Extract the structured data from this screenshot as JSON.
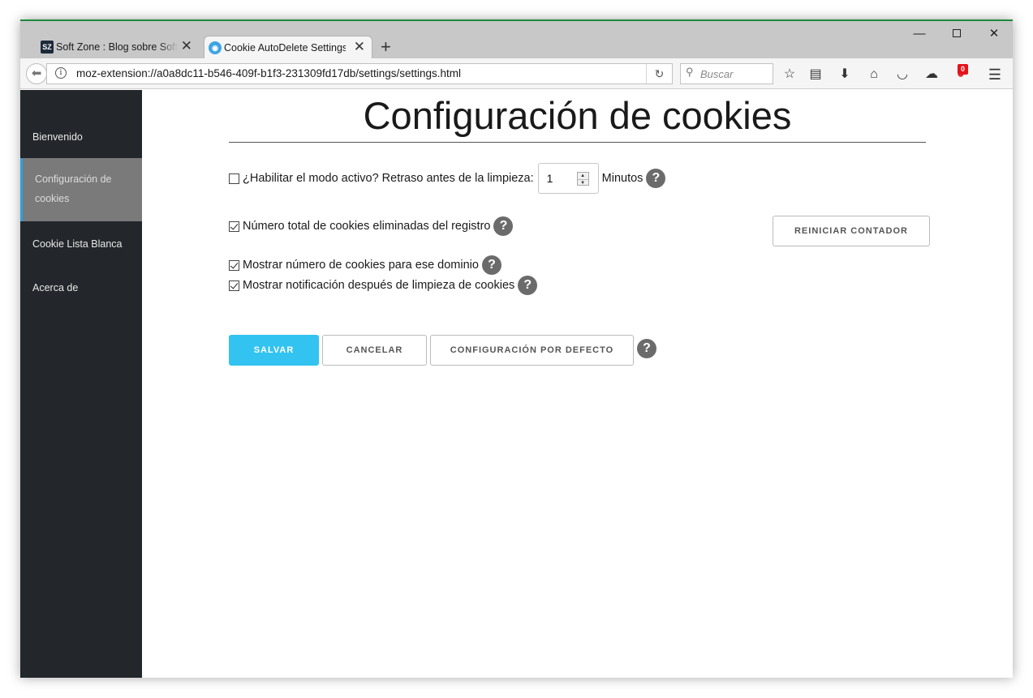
{
  "browser": {
    "tabs": [
      {
        "title": "Soft Zone : Blog sobre Software",
        "favicon": "SZ",
        "active": false
      },
      {
        "title": "Cookie AutoDelete Settings",
        "favicon": "cookie-autodelete-icon",
        "active": true
      }
    ],
    "new_tab": "+",
    "url": "moz-extension://a0a8dc11-b546-409f-b1f3-231309fd17db/settings/settings.html",
    "search_placeholder": "Buscar",
    "badge_count": "0",
    "toolbar_icons": [
      "star-icon",
      "reading-list-icon",
      "download-icon",
      "home-icon",
      "pocket-icon",
      "sync-icon",
      "cookie-autodelete-icon",
      "menu-icon"
    ]
  },
  "sidebar": {
    "items": [
      {
        "label": "Bienvenido",
        "active": false
      },
      {
        "label": "Configuración de cookies",
        "active": true
      },
      {
        "label": "Cookie Lista Blanca",
        "active": false
      },
      {
        "label": "Acerca de",
        "active": false
      }
    ]
  },
  "main": {
    "title": "Configuración de cookies",
    "active_mode": {
      "label": "¿Habilitar el modo activo? Retraso antes de la limpieza:",
      "checked": false,
      "delay_value": "1",
      "unit": "Minutos"
    },
    "stat_logging": {
      "label": "Número total de cookies eliminadas del registro",
      "checked": true
    },
    "reset_counter": "REINICIAR CONTADOR",
    "show_number": {
      "label": "Mostrar número de cookies para ese dominio",
      "checked": true
    },
    "show_notification": {
      "label": "Mostrar notificación después de limpieza de cookies",
      "checked": true
    },
    "buttons": {
      "save": "SALVAR",
      "cancel": "CANCELAR",
      "defaults": "CONFIGURACIÓN POR DEFECTO"
    },
    "help_glyph": "?"
  },
  "colors": {
    "sidebar_bg": "#23272b",
    "sidebar_active_bg": "#7a7a7a",
    "sidebar_active_border": "#2f9fdb",
    "primary_button": "#33c3f0",
    "help_icon": "#6b6b6b",
    "badge": "#e5121a"
  }
}
